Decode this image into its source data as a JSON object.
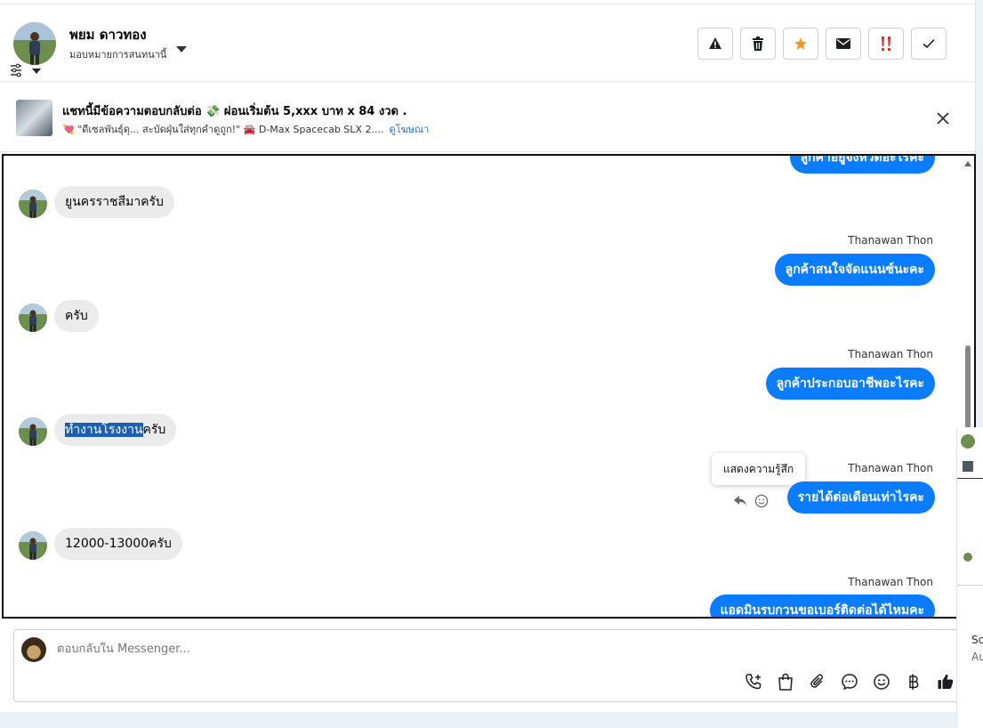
{
  "header": {
    "contact_name": "พยม ดาวทอง",
    "assign_label": "มอบหมายการสนทนานี้",
    "actions": [
      "spam-warning",
      "delete",
      "star",
      "mark-unread",
      "important",
      "done"
    ]
  },
  "ad_banner": {
    "title": "แชทนี้มีข้อความตอบกลับต่อ 💸 ผ่อนเริ่มต้น 5,xxx บาท x 84 งวด .",
    "subtitle": "💘 \"ดีเซลพันธุ์ดุ... สะบัดฝุ่นใส่ทุกคำดูถูก!\" 🚘 D-Max Spacecab SLX 2....",
    "link": "ดูโฆษณา"
  },
  "messages": {
    "top_cut": "ลูกค้าอยู่จังหวัดอะไรคะ",
    "m1": "ยูนครราชสีมาครับ",
    "sender": "Thanawan Thon",
    "m2": "ลูกค้าสนใจจัดแนนซ์นะคะ",
    "m3": "ครับ",
    "m4": "ลูกค้าประกอบอาชีพอะไรคะ",
    "m5_highlight": "ทำงานโรงงาน",
    "m5_rest": "ครับ",
    "m6": "รายได้ต่อเดือนเท่าไรคะ",
    "m7": "12000-13000ครับ",
    "m8": "แอดมินรบกวนขอเบอร์ติดต่อได้ไหมคะ",
    "tooltip": "แสดงความรู้สึก"
  },
  "composer": {
    "placeholder": "ตอบกลับใน Messenger..."
  },
  "peek": {
    "text1": "Sc",
    "text2": "Au"
  },
  "colors": {
    "accent": "#0a7cff",
    "incoming_bubble": "#ebebeb",
    "star": "#f7931e",
    "important": "#e02020"
  }
}
